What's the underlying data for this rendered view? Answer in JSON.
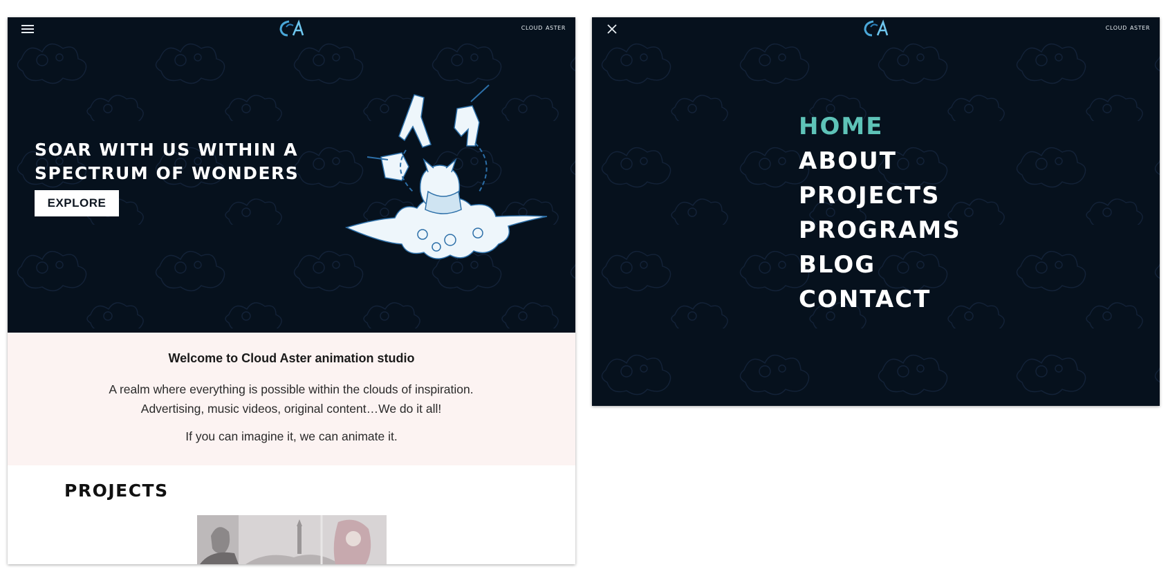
{
  "brand": {
    "name": "CLOUD ASTER",
    "logo_icon": "cloud-aster-logo",
    "colors": {
      "background": "#06111d",
      "accent": "#5ec3b8",
      "welcome_bg": "#fcf3f2"
    }
  },
  "home": {
    "header": {
      "menu_icon": "hamburger-menu-icon"
    },
    "hero": {
      "title_line1": "SOAR WITH US WITHIN A",
      "title_line2": "SPECTRUM OF WONDERS",
      "cta_label": "EXPLORE",
      "illustration": "cat-warrior-on-cloud-illustration"
    },
    "welcome": {
      "heading": "Welcome to Cloud Aster animation studio",
      "body": "A realm where everything is possible within the clouds of inspiration. Advertising, music videos, original content…We do it all!",
      "tagline": "If you can imagine it, we can animate it."
    },
    "projects": {
      "heading": "PROJECTS",
      "thumbnail": "project-sketch-thumbnail"
    }
  },
  "menu": {
    "header": {
      "close_icon": "close-icon"
    },
    "items": [
      {
        "label": "HOME",
        "active": true
      },
      {
        "label": "ABOUT",
        "active": false
      },
      {
        "label": "PROJECTS",
        "active": false
      },
      {
        "label": "PROGRAMS",
        "active": false
      },
      {
        "label": "BLOG",
        "active": false
      },
      {
        "label": "CONTACT",
        "active": false
      }
    ]
  }
}
